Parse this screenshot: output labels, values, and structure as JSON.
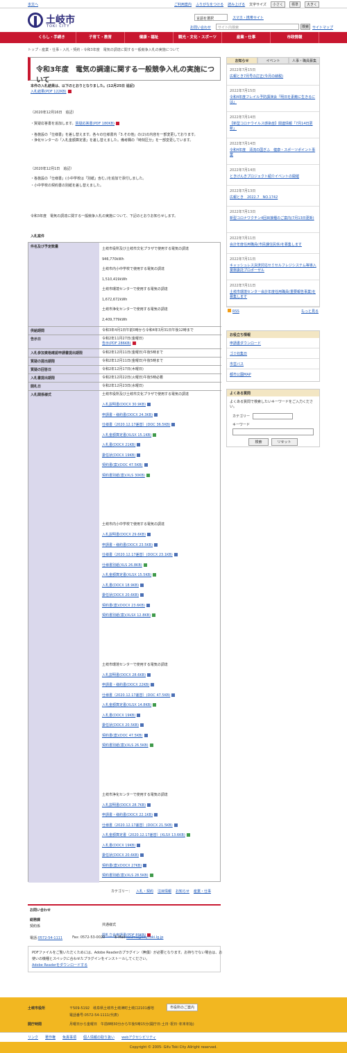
{
  "top": {
    "skip": "本文へ",
    "util": [
      "ご利用案内",
      "ふりがなをつける",
      "読み上げる"
    ],
    "text_size": "文字サイズ",
    "sizes": [
      "小さく",
      "標準",
      "大きく"
    ]
  },
  "header": {
    "logo_ja": "土岐市",
    "logo_en": "TOKI CITY",
    "translate": "言語を選択",
    "smartphone": "スマホ・携帯サイト",
    "inquiry": "お問い合わせ",
    "search_placeholder": "サイト内検索",
    "search_btn": "検索",
    "sitemap": "サイトマップ"
  },
  "gnav": [
    "くらし・手続き",
    "子育て・教育",
    "健康・福祉",
    "観光・文化・スポーツ",
    "産業・仕事",
    "市政情報"
  ],
  "breadcrumb": "トップ › 産業・仕事 › 入札・契約 › 令和3年度　電気の調達に関する一般競争入札の実施について",
  "page_title": "令和3年度　電気の調達に関する一般競争入札の実施について",
  "result_note": "本件の入札結果は、以下のとおりとなりました。(12月25日 追記)",
  "result_link": "入札結果(PDF 122KB)",
  "upd1": {
    "date": "（2020年12月16日　追記）",
    "l1a": "・質疑応答書を追加します。",
    "l1b": "質疑応答書(PDF 180KB)",
    "l2": "・各施設の「仕様書」を差し替えます。各々の仕様書内「3.その他」の(2)の内容を一部変更しております。",
    "l3": "・浄化センターの「入札金額算定書」を差し替えました。備考欄の「時刻区分」を一部変更しています。"
  },
  "upd2": {
    "date": "（2020年12月1日　追記）",
    "l1": "・各施設の「仕様書」(小中学校は「別紙」含む。)を追加で添付しました。",
    "l2": "・小中学校の契約書の別紙を差し替えました。"
  },
  "intro": "令和3年度　電気の調達に関する一般競争入札の実施について、下記のとおりお知らせします。",
  "table_caption": "入札案件",
  "rows": [
    {
      "h": "件名及び予定数量",
      "v": [
        "土岐市役所及び土岐市文化プラザで使用する電気の調達",
        "946,770kWh",
        "土岐市内小中学校で使用する電気の調達",
        "1,510,419kWh",
        "土岐市環境センターで使用する電気の調達",
        "1,672,672kWh",
        "土岐市浄化センターで使用する電気の調達",
        "2,409,779kWh"
      ]
    },
    {
      "h": "供給期間",
      "v": [
        "令和3年4月1日午前0時から令和4年3月31日午後12時まで"
      ]
    },
    {
      "h": "告示日",
      "v": [
        "令和2年11月27日(金曜日)"
      ],
      "link": "告示(PDF 286KB)"
    },
    {
      "h": "入札参加資格確認申請書提出期限",
      "v": [
        "令和2年12月11日(金曜日)午後5時まで"
      ]
    },
    {
      "h": "質疑の提出期限",
      "v": [
        "令和2年12月11日(金曜日)午後5時まで"
      ]
    },
    {
      "h": "質疑の回答日",
      "v": [
        "令和2年12月17日(木曜日)"
      ]
    },
    {
      "h": "入札書提出期限",
      "v": [
        "令和2年12月22日(火曜日)午後5時必着"
      ]
    },
    {
      "h": "開札日",
      "v": [
        "令和2年12月23日(水曜日)"
      ]
    }
  ],
  "forms_header": "入札関係様式",
  "groups": [
    {
      "title": "土岐市役所及び土岐市文化プラザで使用する電気の調達",
      "links": [
        [
          "入札説明書(DOCX 30.9KB)",
          "doc"
        ],
        [
          "申請書・様約書(DOCX 24.3KB)",
          "doc"
        ],
        [
          "仕様書（2020.12.17差替）(DOC 36.5KB)",
          "doc"
        ],
        [
          "入札金額算定書(XLSX 15.1KB)",
          "xls"
        ],
        [
          "入札書(DOCX 21KB)",
          "doc"
        ],
        [
          "委任状(DOCX 19KB)",
          "doc"
        ],
        [
          "契約書(案)(DOC 47.5KB)",
          "doc"
        ],
        [
          "契約書別紙(案)(XLS 30KB)",
          "xls"
        ]
      ]
    },
    {
      "title": "土岐市内小中学校で使用する電気の調達",
      "links": [
        [
          "入札説明書(DOCX 29.6KB)",
          "doc"
        ],
        [
          "申請書・様約書(DOCX 23.5KB)",
          "doc"
        ],
        [
          "仕様書（2020.12.17差替）(DOCX 23.1KB)",
          "doc"
        ],
        [
          "仕様書別紙(XLS 26.8KB)",
          "xls"
        ],
        [
          "入札金額算定書(XLSX 15.5KB)",
          "xls"
        ],
        [
          "入札書(DOCX 18.9KB)",
          "doc"
        ],
        [
          "委任状(DOCX 20.6KB)",
          "doc"
        ],
        [
          "契約書(案)(DOCX 23.6KB)",
          "doc"
        ],
        [
          "契約書別紙(案)(XLSX 12.8KB)",
          "xls"
        ]
      ]
    },
    {
      "title": "土岐市環境センターで使用する電気の調達",
      "links": [
        [
          "入札説明書(DOCX 28.6KB)",
          "doc"
        ],
        [
          "申請書・様約書(DOCX 22KB)",
          "doc"
        ],
        [
          "仕様書（2020.12.17差替）(DOC 47.5KB)",
          "doc"
        ],
        [
          "入札金額算定書(XLSX 14.8KB)",
          "xls"
        ],
        [
          "入札書(DOCX 19KB)",
          "doc"
        ],
        [
          "委任状(DOCX 20.5KB)",
          "doc"
        ],
        [
          "契約書(案)(DOC 47.5KB)",
          "doc"
        ],
        [
          "契約書別紙(案)(XLS 26.5KB)",
          "xls"
        ]
      ]
    },
    {
      "title": "土岐市浄化センターで使用する電気の調達",
      "links": [
        [
          "入札説明書(DOCX 28.7KB)",
          "doc"
        ],
        [
          "申請書・様約書(DOCX 22.1KB)",
          "doc"
        ],
        [
          "仕様書（2020.12.17差替）(DOCX 21.5KB)",
          "doc"
        ],
        [
          "入札金額算定書（2020.12.17差替）(XLSX 13.6KB)",
          "xls"
        ],
        [
          "入札書(DOCX 19KB)",
          "doc"
        ],
        [
          "委任状(DOCX 20.6KB)",
          "doc"
        ],
        [
          "契約書(案)(DOCX 27KB)",
          "doc"
        ],
        [
          "契約書別紙(案)(XLS 28.5KB)",
          "xls"
        ]
      ]
    }
  ],
  "common": {
    "title": "共通様式",
    "link": "開札立会申請書(PDF 89KB)"
  },
  "category": {
    "label": "カテゴリー：",
    "items": [
      "入札・契約",
      "注目情報",
      "お知らせ",
      "産業・仕事"
    ]
  },
  "contact": {
    "head": "お問い合わせ",
    "dept": "総務課",
    "sec": "契約係",
    "tel_label": "電話:",
    "tel": "0572-54-1111",
    "fax": "Fax: 0572-53-0020",
    "mail_label": "E-Mail:",
    "mail": "soumu@city.toki.lg.jp"
  },
  "adobe": {
    "l1": "PDFファイルをご覧いただくためには、Adobe Readerのプラグイン（無償）が必要となります。お持ちでない場合は、お",
    "l2": "使いの機種とスペックに合わせたプラグインをインストールしてください。",
    "link": "Adobe Readerをダウンロードする"
  },
  "side": {
    "tabs": [
      "お知らせ",
      "イベント",
      "人事・職員募集"
    ],
    "news": [
      [
        "2022年7月15日",
        "広報とき7月号の訂正(今月の納税)"
      ],
      [
        "2022年7月15日",
        "令和4年度フレイル予防講演会「明日を素敵に生きるには」"
      ],
      [
        "2022年7月14日",
        "【新型コロナウイルス感染症】関連情報「7月14日更新」"
      ],
      [
        "2022年7月14日",
        "令和4年度　清流の国ぎふ　健康・スポーツポイント事業"
      ],
      [
        "2022年7月14日",
        "ときげんきプロジェクト紹介イベントの開催"
      ],
      [
        "2022年7月13日",
        "広報とき　2022.7　NO.1742"
      ],
      [
        "2022年7月13日",
        "新型コロナワクチン4回目接種のご案内(7月13日更新)"
      ],
      [
        "2022年7月11日",
        "会計年度任用職員(市民課住民係)を募集します"
      ],
      [
        "2022年7月11日",
        "キャッシュレス決済対応セミセルフレジシステム等導入業務委託プロポーザル"
      ],
      [
        "2022年7月11日",
        "土岐市環境センター会計年度任用職員(重要報告事業)を募集します"
      ]
    ],
    "rss": "RSS",
    "more": "もっと見る",
    "useful_head": "お役立ち情報",
    "useful": [
      "申請書ダウンロード",
      "ゴミ収集日",
      "市営バス",
      "都市公園MAP"
    ],
    "faq_head": "よくある質問",
    "faq_text": "よくある質問で検索したいキーワードをご入力ください。",
    "cat_label": "カテゴリー",
    "kw_label": "キーワード",
    "search": "検索",
    "reset": "リセット"
  },
  "footer": {
    "name": "土岐市役所",
    "addr": "〒509-5192　岐阜県土岐市土岐津町土岐口2101番地",
    "tel": "電話番号:0572-54-1111(代表)",
    "map_btn": "市役所のご案内",
    "hours_label": "開庁時間",
    "hours": "月曜日から金曜日　午前8時30分から午後5時15分(開庁日:土日･祝日･年末年始)"
  },
  "fnav": [
    "リンク",
    "著作権",
    "免責事項",
    "個人情報の取り扱い",
    "webアクセシビリティ"
  ],
  "copyright": "Copyright © 2005- Gifu Toki City Allright reserved."
}
